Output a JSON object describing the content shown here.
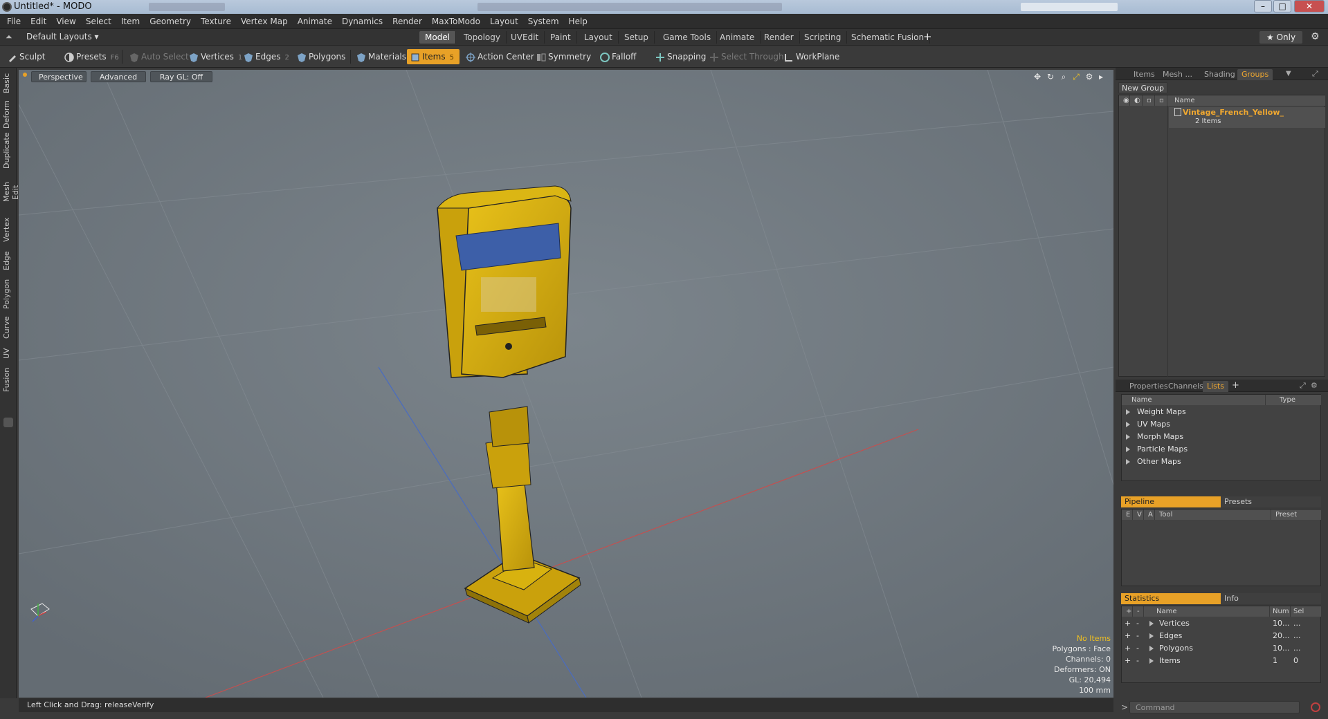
{
  "window": {
    "title": "Untitled* - MODO"
  },
  "menu": [
    "File",
    "Edit",
    "View",
    "Select",
    "Item",
    "Geometry",
    "Texture",
    "Vertex Map",
    "Animate",
    "Dynamics",
    "Render",
    "MaxToModo",
    "Layout",
    "System",
    "Help"
  ],
  "layout_row": {
    "default_layouts": "Default Layouts ▾",
    "tabs": [
      "Model",
      "Topology",
      "UVEdit",
      "Paint",
      "Layout",
      "Setup",
      "Game Tools",
      "Animate",
      "Render",
      "Scripting",
      "Schematic Fusion"
    ],
    "active_tab": "Model",
    "add": "+",
    "only": "★ Only"
  },
  "toolbar": {
    "sculpt": "Sculpt",
    "presets": "Presets",
    "presets_key": "F6",
    "auto_select": "Auto Select",
    "vertices": "Vertices",
    "vertices_num": "1",
    "edges": "Edges",
    "edges_num": "2",
    "polygons": "Polygons",
    "materials": "Materials",
    "items": "Items",
    "items_num": "5",
    "action_center": "Action Center",
    "symmetry": "Symmetry",
    "falloff": "Falloff",
    "snapping": "Snapping",
    "select_through": "Select Through",
    "workplane": "WorkPlane"
  },
  "left_tabs": [
    "Basic",
    "Deform",
    "Duplicate",
    "Mesh Edit",
    "Vertex",
    "Edge",
    "Polygon",
    "Curve",
    "UV",
    "Fusion"
  ],
  "viewport": {
    "perspective": "Perspective",
    "advanced": "Advanced",
    "raygl": "Ray GL: Off",
    "hud": {
      "no_items": "No Items",
      "polygons": "Polygons : Face",
      "channels": "Channels: 0",
      "deformers": "Deformers: ON",
      "gl": "GL: 20,494",
      "scale": "100 mm"
    }
  },
  "status": {
    "text": "Left Click and Drag:  releaseVerify"
  },
  "groups_panel": {
    "tabs": [
      "Items",
      "Mesh ...",
      "Shading",
      "Groups"
    ],
    "active_tab": "Groups",
    "new_group": "New Group",
    "col_name": "Name",
    "group_name": "Vintage_French_Yellow_",
    "group_sub": "2 Items"
  },
  "lists_panel": {
    "tabs": [
      "Properties",
      "Channels",
      "Lists"
    ],
    "active_tab": "Lists",
    "col_name": "Name",
    "col_type": "Type",
    "rows": [
      "Weight Maps",
      "UV Maps",
      "Morph Maps",
      "Particle Maps",
      "Other Maps"
    ]
  },
  "pipeline_panel": {
    "tabs": [
      "Pipeline",
      "Presets"
    ],
    "cols": [
      "E",
      "V",
      "A",
      "Tool",
      "Preset"
    ]
  },
  "stats_panel": {
    "tabs": [
      "Statistics",
      "Info"
    ],
    "cols": [
      "Name",
      "Num",
      "Sel"
    ],
    "rows": [
      {
        "name": "Vertices",
        "num": "10...",
        "sel": "..."
      },
      {
        "name": "Edges",
        "num": "20...",
        "sel": "..."
      },
      {
        "name": "Polygons",
        "num": "10...",
        "sel": "..."
      },
      {
        "name": "Items",
        "num": "1",
        "sel": "0"
      }
    ]
  },
  "command": {
    "placeholder": "Command"
  },
  "colors": {
    "accent": "#e8a127",
    "viewport_bg": "#6f7880",
    "model_yellow": "#e2b80f"
  }
}
